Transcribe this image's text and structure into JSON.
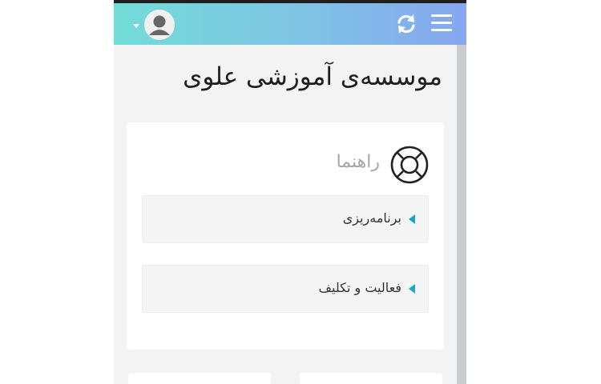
{
  "app": {
    "title": "موسسه‌ی آموزشی علوی"
  },
  "header": {
    "icons": [
      "menu-icon",
      "sync-icon",
      "user-avatar-icon",
      "caret-down-icon"
    ],
    "colors": {
      "gradient_start": "#72dcd6",
      "gradient_end": "#86a6ef"
    }
  },
  "guide_card": {
    "title": "راهنما",
    "icon": "lifebuoy-icon",
    "items": [
      {
        "label": "برنامه‌ریزی",
        "icon": "caret-left-icon"
      },
      {
        "label": "فعالیت و تکلیف",
        "icon": "caret-left-icon"
      }
    ],
    "accent_color": "#19a7c8"
  }
}
